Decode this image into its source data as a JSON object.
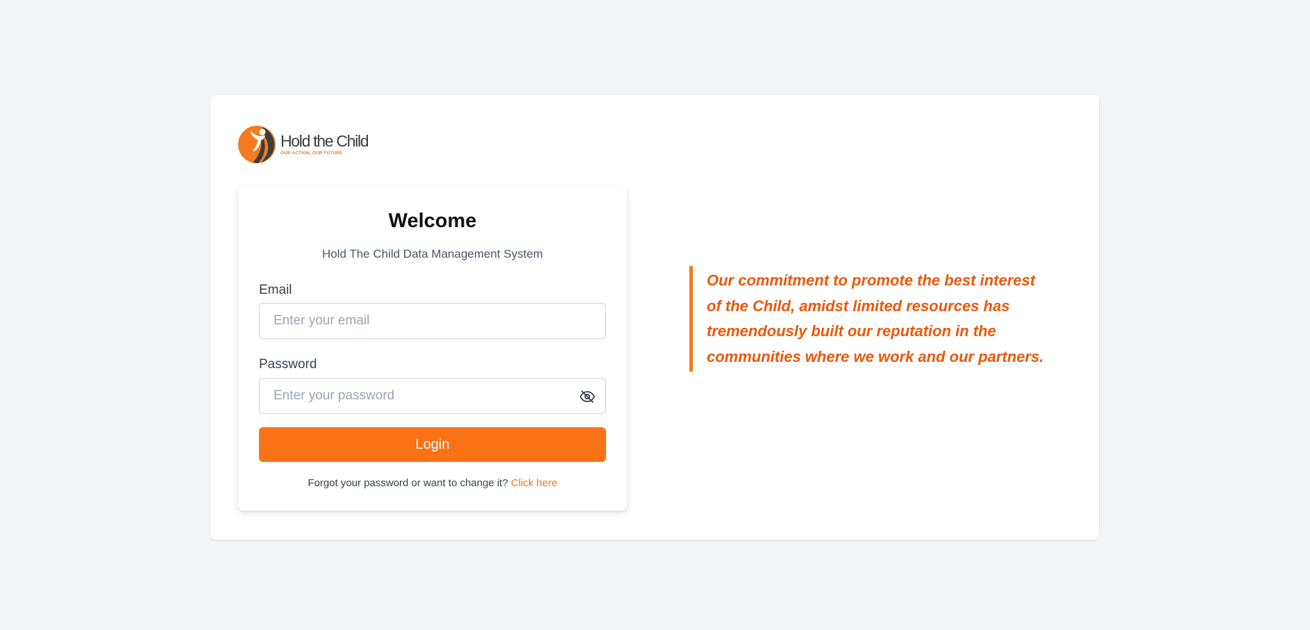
{
  "brand": {
    "name": "Hold the Child",
    "tagline": "OUR ACTION. OUR FUTURE",
    "logo_icon": "child-figure-logo-icon",
    "accent_color": "#f47b20",
    "dark_color": "#3d3d3d"
  },
  "login": {
    "title": "Welcome",
    "subtitle": "Hold The Child Data Management System",
    "email_label": "Email",
    "email_placeholder": "Enter your email",
    "email_value": "",
    "password_label": "Password",
    "password_placeholder": "Enter your password",
    "password_value": "",
    "password_toggle_icon": "eye-off-icon",
    "submit_label": "Login",
    "button_color": "#f97316",
    "forgot_text": "Forgot your password or want to change it?",
    "forgot_link": "Click here"
  },
  "quote": {
    "text": "Our commitment to promote the best interest of the Child, amidst limited resources has tremendously built our reputation in the communities where we work and our partners.",
    "color": "#ea580c"
  }
}
